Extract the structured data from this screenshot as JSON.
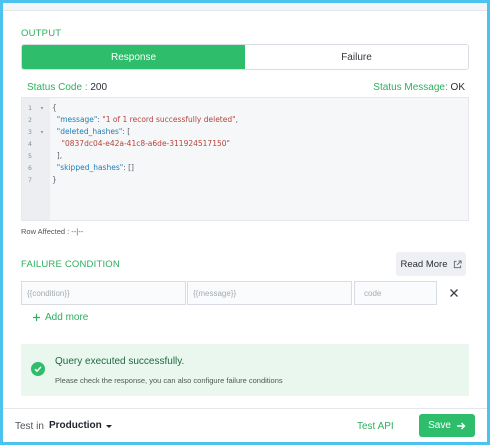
{
  "output": {
    "section_title": "OUTPUT",
    "tabs": [
      {
        "label": "Response",
        "active": true
      },
      {
        "label": "Failure",
        "active": false
      }
    ],
    "status_code_label": "Status Code :",
    "status_code_value": "200",
    "status_message_label": "Status Message:",
    "status_message_value": "OK",
    "editor": {
      "line_numbers": [
        "1",
        "2",
        "3",
        "4",
        "5",
        "6",
        "7"
      ],
      "fold_markers": [
        "▾",
        "",
        "▾",
        "",
        "",
        "",
        ""
      ],
      "lines": [
        [
          {
            "t": "{",
            "c": "p"
          }
        ],
        [
          {
            "t": "  \"message\"",
            "c": "k"
          },
          {
            "t": ": ",
            "c": "p"
          },
          {
            "t": "\"1 of 1 record successfully deleted\"",
            "c": "s"
          },
          {
            "t": ",",
            "c": "p"
          }
        ],
        [
          {
            "t": "  \"deleted_hashes\"",
            "c": "k"
          },
          {
            "t": ": [",
            "c": "p"
          }
        ],
        [
          {
            "t": "    \"0837dc04-e42a-41c8-a6de-311924517150\"",
            "c": "s"
          }
        ],
        [
          {
            "t": "  ],",
            "c": "p"
          }
        ],
        [
          {
            "t": "  \"skipped_hashes\"",
            "c": "k"
          },
          {
            "t": ": []",
            "c": "p"
          }
        ],
        [
          {
            "t": "}",
            "c": "p"
          }
        ]
      ]
    },
    "rows_affected": "Row Affected : --|--"
  },
  "failure_condition": {
    "section_title": "FAILURE CONDITION",
    "read_more_label": "Read More",
    "read_more_icon": "external-link-icon",
    "condition_placeholder": "{{condition}}",
    "message_placeholder": "{{message}}",
    "code_placeholder": "code",
    "remove_icon": "close-icon",
    "add_more_label": "Add more"
  },
  "success_banner": {
    "icon": "check-circle-icon",
    "title": "Query executed successfully.",
    "subtitle": "Please check the response, you can also configure failure conditions"
  },
  "footer": {
    "test_in_label": "Test in",
    "environment": "Production",
    "test_api_label": "Test API",
    "save_label": "Save",
    "save_icon": "arrow-right-icon"
  },
  "colors": {
    "accent_green": "#2ebd6b",
    "label_green": "#2fae5f",
    "frame_blue": "#4cc3ee"
  }
}
